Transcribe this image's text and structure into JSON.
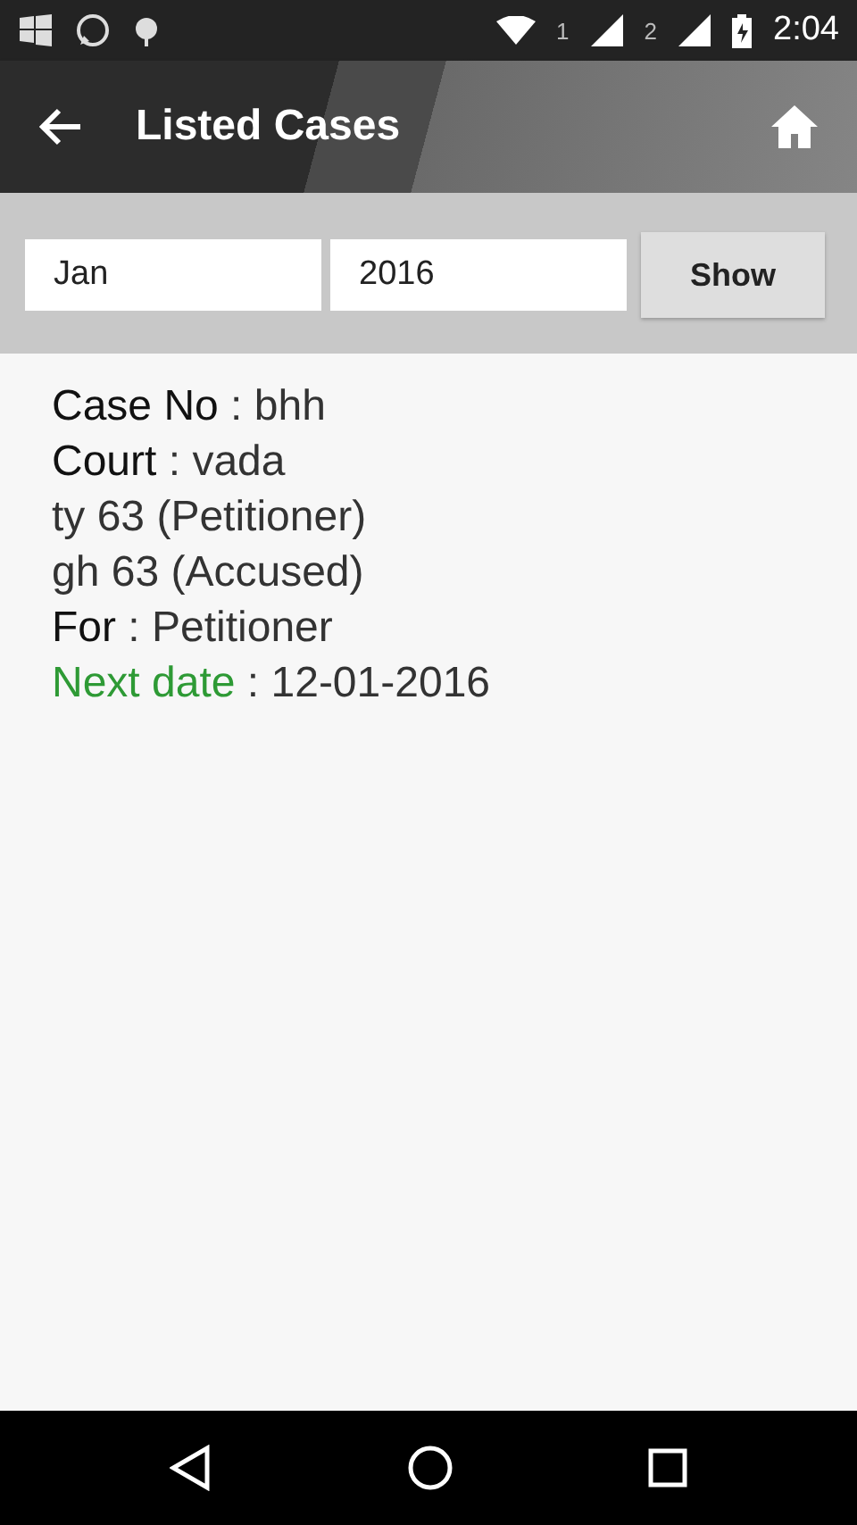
{
  "status_bar": {
    "sim_1": "1",
    "sim_2": "2",
    "time": "2:04"
  },
  "app_bar": {
    "title": "Listed Cases"
  },
  "filter": {
    "month": "Jan",
    "year": "2016",
    "button": "Show"
  },
  "case": {
    "lines": [
      {
        "kind": "field",
        "label": "Case No",
        "value": ": bhh"
      },
      {
        "kind": "field",
        "label": "Court",
        "value": ": vada"
      },
      {
        "kind": "plain",
        "value": "ty 63 (Petitioner)"
      },
      {
        "kind": "plain",
        "value": "gh 63 (Accused)"
      },
      {
        "kind": "field",
        "label": "For",
        "value": ": Petitioner"
      },
      {
        "kind": "field",
        "label": "Next date",
        "value": ": 12-01-2016",
        "color": "#2e9a35"
      }
    ]
  }
}
